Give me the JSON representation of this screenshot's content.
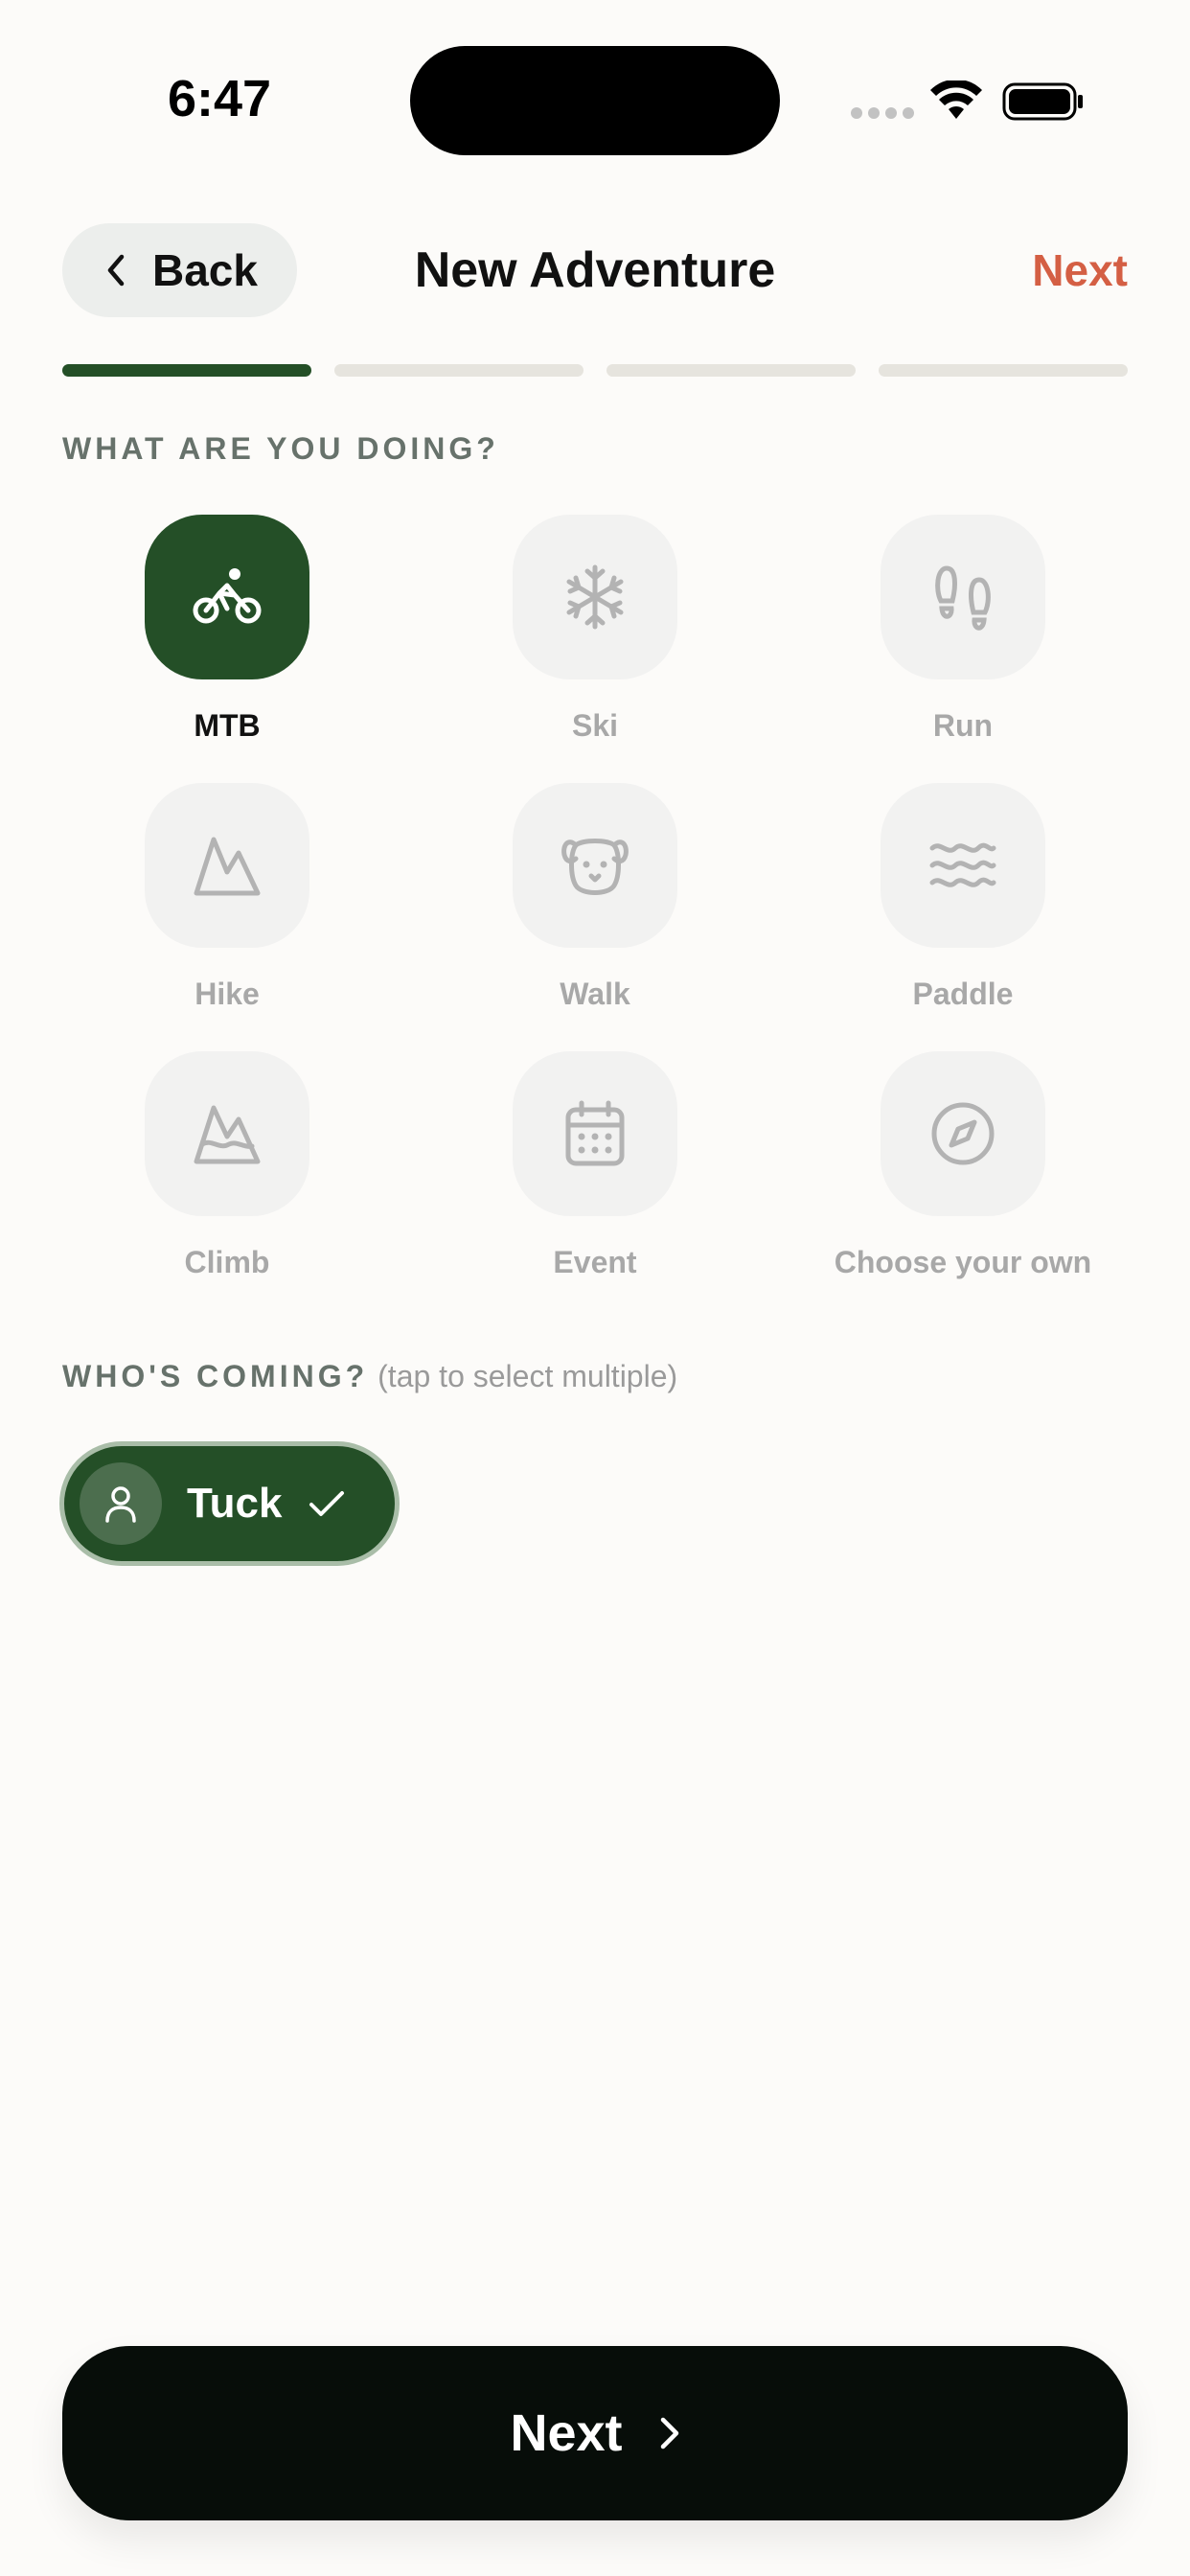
{
  "status_bar": {
    "time": "6:47"
  },
  "nav": {
    "back_label": "Back",
    "title": "New Adventure",
    "next_label": "Next"
  },
  "progress": {
    "total_steps": 4,
    "current_step": 1
  },
  "activity_section": {
    "heading": "WHAT ARE YOU DOING?"
  },
  "activities": [
    {
      "label": "MTB",
      "icon": "bike-icon",
      "selected": true
    },
    {
      "label": "Ski",
      "icon": "snowflake-icon",
      "selected": false
    },
    {
      "label": "Run",
      "icon": "footprints-icon",
      "selected": false
    },
    {
      "label": "Hike",
      "icon": "mountain-icon",
      "selected": false
    },
    {
      "label": "Walk",
      "icon": "dog-icon",
      "selected": false
    },
    {
      "label": "Paddle",
      "icon": "waves-icon",
      "selected": false
    },
    {
      "label": "Climb",
      "icon": "mountain-snow-icon",
      "selected": false
    },
    {
      "label": "Event",
      "icon": "calendar-icon",
      "selected": false
    },
    {
      "label": "Choose your own",
      "icon": "compass-icon",
      "selected": false
    }
  ],
  "companions_section": {
    "heading": "WHO'S COMING?",
    "hint": "(tap to select multiple)"
  },
  "companions": [
    {
      "name": "Tuck",
      "selected": true,
      "icon": "user-icon"
    }
  ],
  "footer": {
    "next_label": "Next"
  },
  "colors": {
    "accent": "#244f27",
    "next_link": "#d45f44",
    "button": "#070d09"
  }
}
